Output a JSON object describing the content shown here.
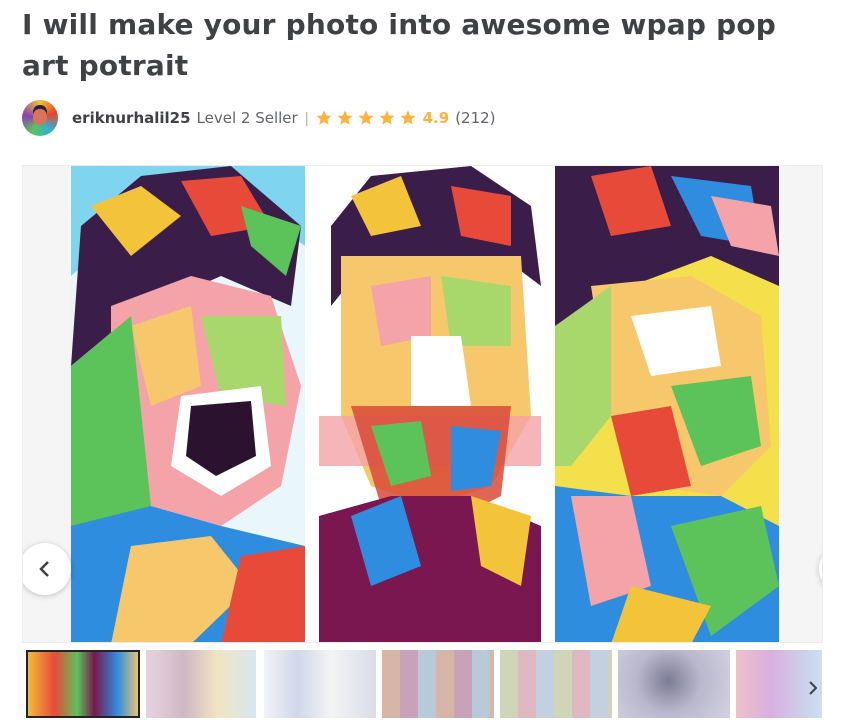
{
  "gig": {
    "title": "I will make your photo into awesome wpap pop art potrait"
  },
  "seller": {
    "username": "eriknurhalil25",
    "level": "Level 2 Seller",
    "divider": "|",
    "rating": "4.9",
    "review_count": "(212)",
    "stars": 5,
    "star_color": "#ffb33e"
  },
  "gallery": {
    "icons": {
      "prev": "chevron-left-icon",
      "next": "chevron-right-icon",
      "thumbs_next": "chevron-right-icon"
    },
    "thumbnail_count": 7
  }
}
